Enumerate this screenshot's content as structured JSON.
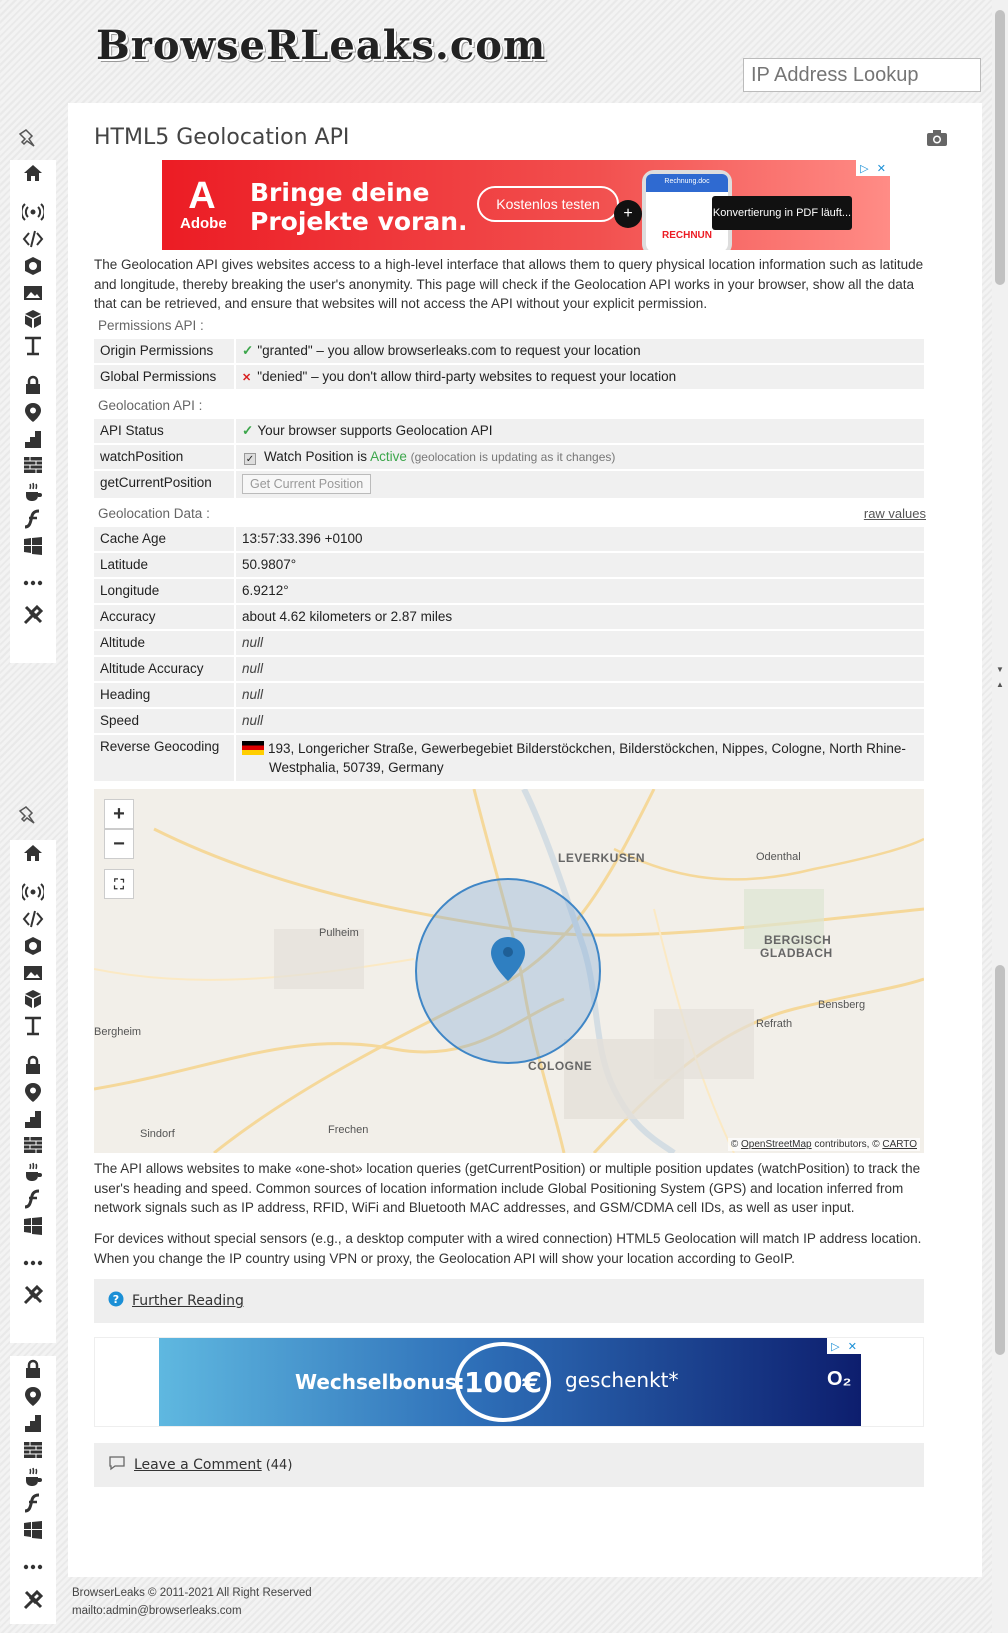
{
  "header": {
    "logo_text": "BrowseRLeaks.com",
    "search_placeholder": "IP Address Lookup"
  },
  "page": {
    "title": "HTML5 Geolocation API",
    "intro": "The Geolocation API gives websites access to a high-level interface that allows them to query physical location information such as latitude and longitude, thereby breaking the user's anonymity. This page will check if the Geolocation API works in your browser, show all the data that can be retrieved, and ensure that websites will not access the API without your explicit permission."
  },
  "ad_top": {
    "brand": "Adobe",
    "headline_1": "Bringe deine",
    "headline_2": "Projekte voran.",
    "cta": "Kostenlos testen",
    "phone_title": "Rechnung.doc",
    "phone_text": "RECHNUN",
    "toast": "Konvertierung in PDF läuft..."
  },
  "permissions": {
    "label": "Permissions API :",
    "rows": [
      {
        "key": "Origin Permissions",
        "value": "\"granted\" – you allow browserleaks.com to request your location",
        "status": "check"
      },
      {
        "key": "Global Permissions",
        "value": "\"denied\" – you don't allow third-party websites to request your location",
        "status": "cross"
      }
    ]
  },
  "geo_api": {
    "label": "Geolocation API :",
    "api_status_key": "API Status",
    "api_status_value": "Your browser supports Geolocation API",
    "watch_key": "watchPosition",
    "watch_prefix": "Watch Position is",
    "watch_state": "Active",
    "watch_note": "(geolocation is updating as it changes)",
    "current_key": "getCurrentPosition",
    "current_button": "Get Current Position"
  },
  "geo_data": {
    "label": "Geolocation Data :",
    "raw_link": "raw values",
    "rows": [
      {
        "key": "Cache Age",
        "value": "13:57:33.396 +0100"
      },
      {
        "key": "Latitude",
        "value": "50.9807°"
      },
      {
        "key": "Longitude",
        "value": "6.9212°"
      },
      {
        "key": "Accuracy",
        "value": "about 4.62 kilometers or 2.87 miles"
      },
      {
        "key": "Altitude",
        "value": "null"
      },
      {
        "key": "Altitude Accuracy",
        "value": "null"
      },
      {
        "key": "Heading",
        "value": "null"
      },
      {
        "key": "Speed",
        "value": "null"
      }
    ],
    "reverse_key": "Reverse Geocoding",
    "reverse_value_1": "193, Longericher Straße, Gewerbegebiet Bilderstöckchen, Bilderstöckchen, Nippes, Cologne, North Rhine-",
    "reverse_value_2": "Westphalia, 50739, Germany"
  },
  "map": {
    "zoom_in": "+",
    "zoom_out": "−",
    "labels": {
      "leverkusen": "LEVERKUSEN",
      "odenthal": "Odenthal",
      "pulheim": "Pulheim",
      "bergisch_1": "BERGISCH",
      "bergisch_2": "GLADBACH",
      "bensberg": "Bensberg",
      "refrath": "Refrath",
      "bergheim": "Bergheim",
      "cologne": "COLOGNE",
      "sindorf": "Sindorf",
      "frechen": "Frechen"
    },
    "attrib_prefix": "©",
    "attrib_osm": "OpenStreetMap",
    "attrib_mid": "contributors, ©",
    "attrib_carto": "CARTO"
  },
  "text": {
    "para1": "The API allows websites to make «one-shot» location queries (getCurrentPosition) or multiple position updates (watchPosition) to track the user's heading and speed. Common sources of location information include Global Positioning System (GPS) and location inferred from network signals such as IP address, RFID, WiFi and Bluetooth MAC addresses, and GSM/CDMA cell IDs, as well as user input.",
    "para2": "For devices without special sensors (e.g., a desktop computer with a wired connection) HTML5 Geolocation will match IP address location. When you change the IP country using VPN or proxy, the Geolocation API will show your location according to GeoIP."
  },
  "further_reading": "Further Reading",
  "ad_bottom": {
    "t1": "Wechselbonus:",
    "amount": "100€",
    "t2": "geschenkt*",
    "brand": "O₂"
  },
  "comments": {
    "label": "Leave a Comment",
    "count": "(44)"
  },
  "footer": {
    "copyright": "BrowserLeaks © 2011-2021 All Right Reserved",
    "mail": "mailto:admin@browserleaks.com"
  },
  "sidebar_icons": [
    "home-icon",
    "signal-icon",
    "code-icon",
    "webgl-icon",
    "image-icon",
    "cube-icon",
    "font-icon",
    "lock-icon",
    "location-icon",
    "chart-icon",
    "bricks-icon",
    "java-icon",
    "flash-icon",
    "windows-icon",
    "more-icon",
    "tools-icon"
  ],
  "colors": {
    "accent_green": "#3ca64b",
    "cross_red": "#d82020",
    "ad_red": "#ec1c24"
  }
}
